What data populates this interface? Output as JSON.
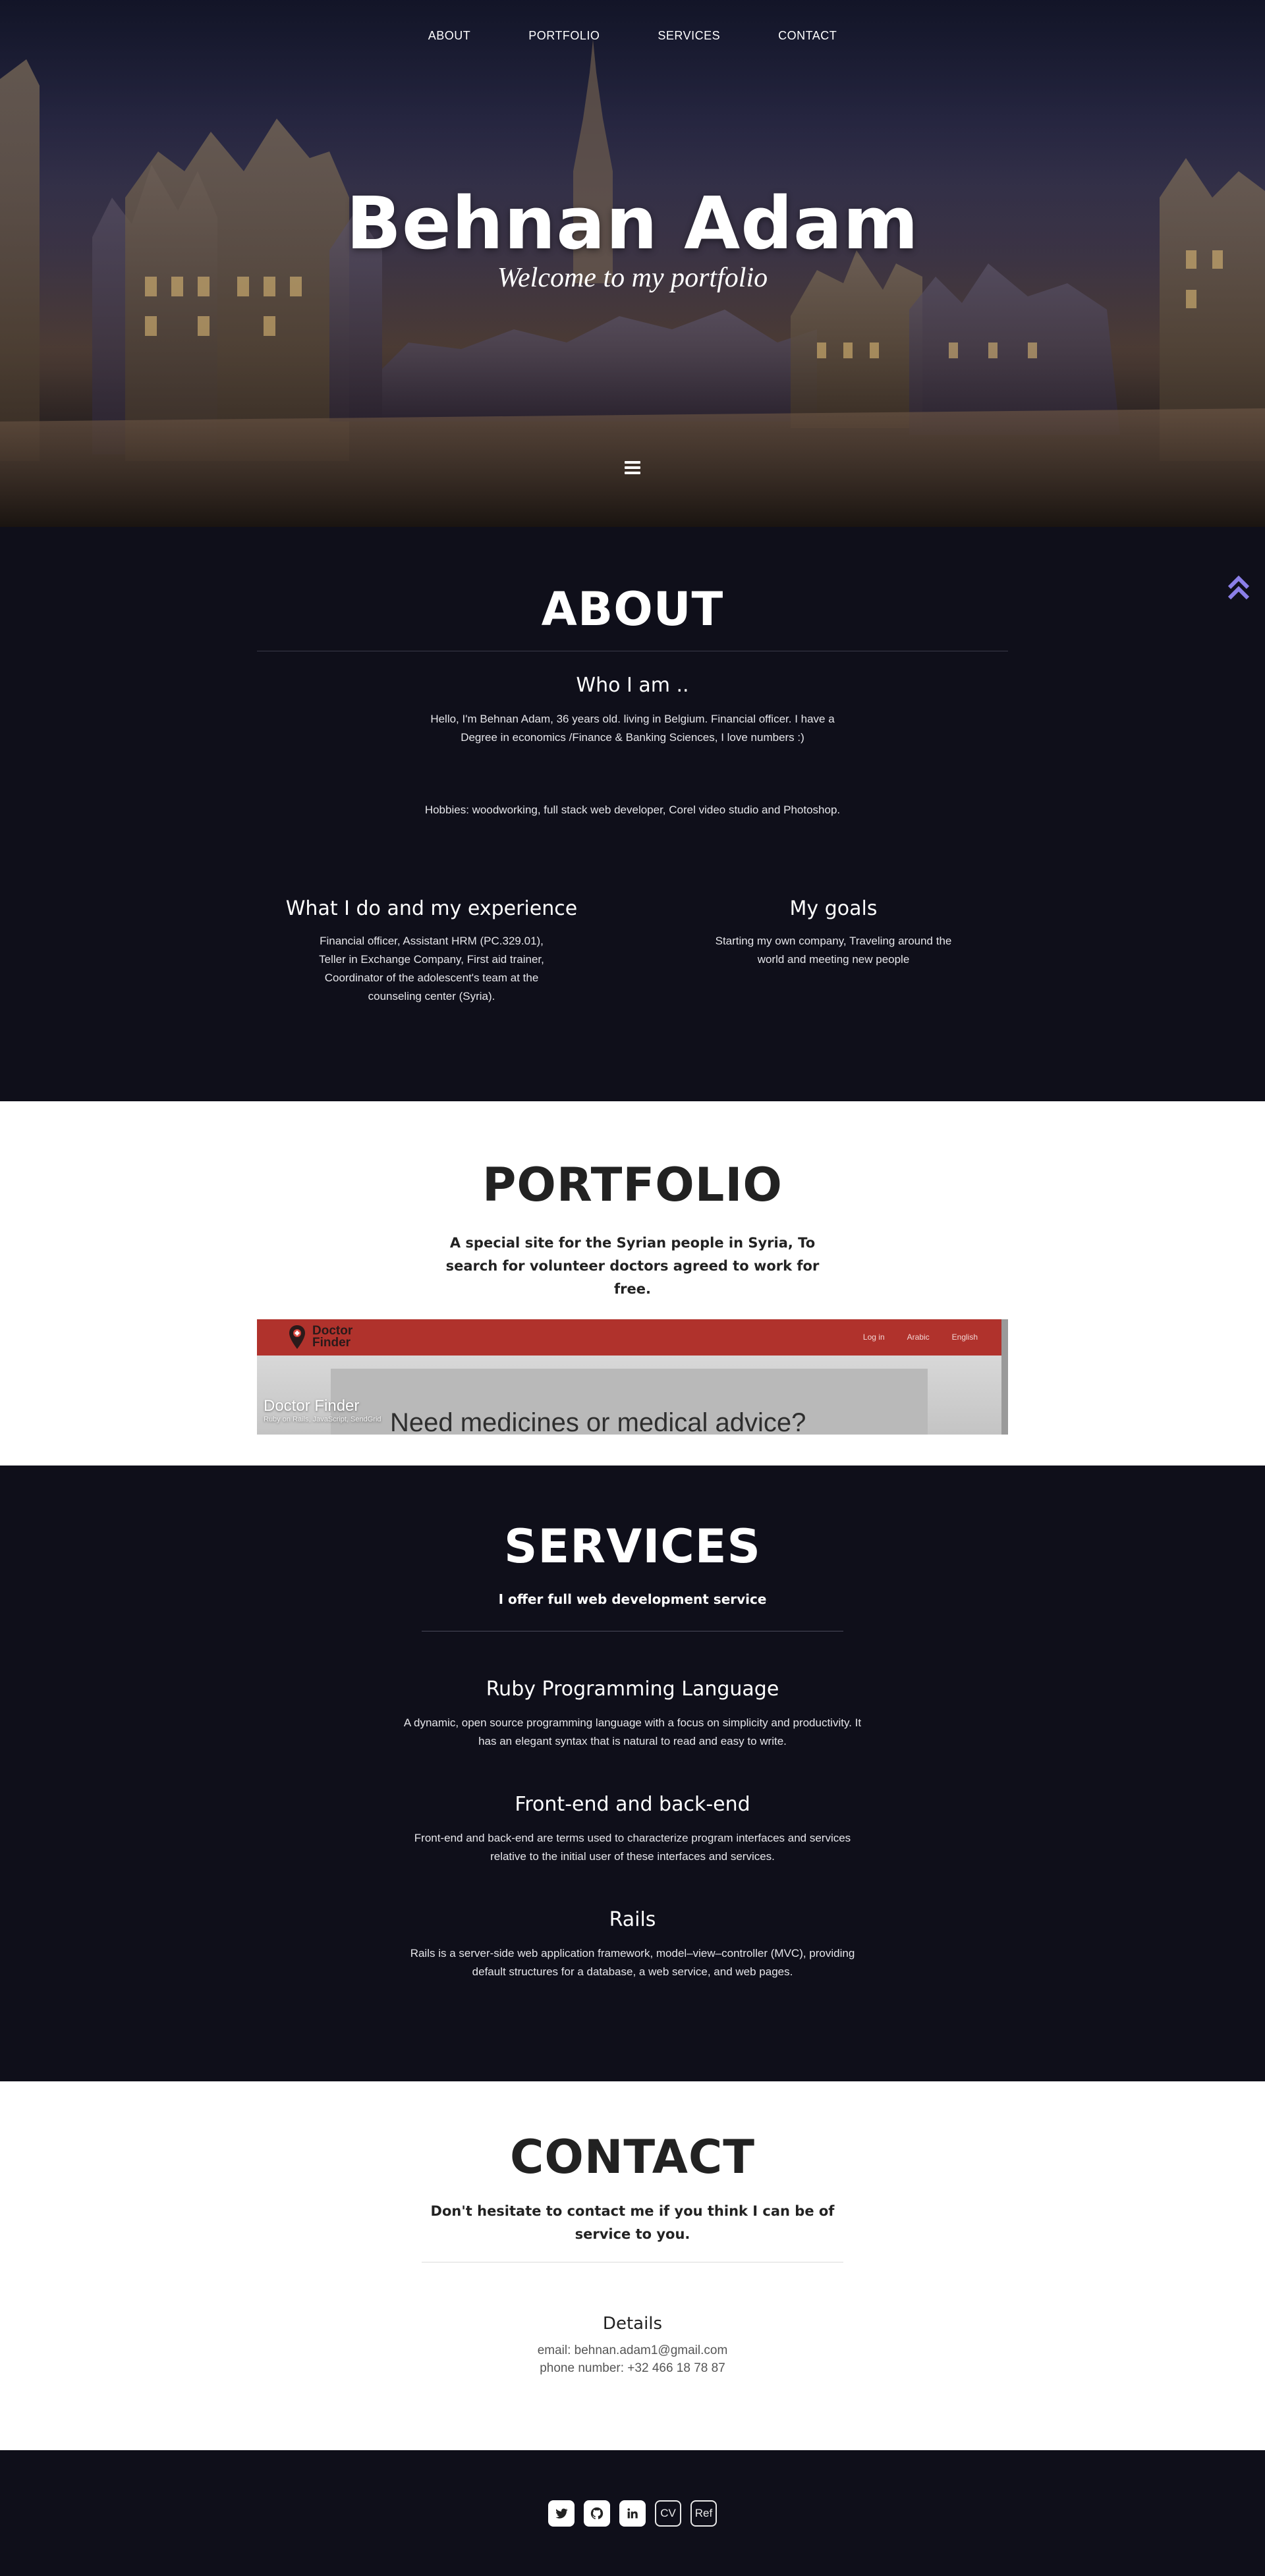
{
  "nav": {
    "about": "ABOUT",
    "portfolio": "PORTFOLIO",
    "services": "SERVICES",
    "contact": "CONTACT"
  },
  "hero": {
    "title": "Behnan Adam",
    "subtitle": "Welcome to my portfolio",
    "menu_icon": "hamburger-icon"
  },
  "about": {
    "title": "ABOUT",
    "who_heading": "Who I am ..",
    "who_text": "Hello, I'm Behnan Adam, 36 years old. living in Belgium. Financial officer. I have a Degree in economics /Finance & Banking Sciences, I love numbers :)",
    "hobbies": "Hobbies: woodworking, full stack web developer, Corel video studio and Photoshop.",
    "experience_heading": "What I do and my experience",
    "experience_text": "Financial officer, Assistant HRM (PC.329.01), Teller in Exchange Company, First aid trainer, Coordinator of the adolescent's team at the counseling center (Syria).",
    "goals_heading": "My goals",
    "goals_text": "Starting my own company, Traveling around the world and meeting new people",
    "back_to_top_icon": "double-chevron-up-icon",
    "back_to_top_color": "#8b7fe8"
  },
  "portfolio": {
    "title": "PORTFOLIO",
    "lead": "A special site for the Syrian people in Syria, To search for volunteer doctors agreed to work for free.",
    "project": {
      "brand_line1": "Doctor",
      "brand_line2": "Finder",
      "links": [
        "Log in",
        "Arabic",
        "English"
      ],
      "headline": "Need medicines or medical advice?",
      "caption_title": "Doctor Finder",
      "caption_sub": "Ruby on Rails, JavaScript, SendGrid",
      "bar_color": "#b0322c"
    }
  },
  "services": {
    "title": "SERVICES",
    "lead": "I offer full web development service",
    "items": [
      {
        "heading": "Ruby Programming Language",
        "text": "A dynamic, open source programming language with a focus on simplicity and productivity. It has an elegant syntax that is natural to read and easy to write."
      },
      {
        "heading": "Front-end and back-end",
        "text": "Front-end and back-end are terms used to characterize program interfaces and services relative to the initial user of these interfaces and services."
      },
      {
        "heading": "Rails",
        "text": "Rails is a server-side web application framework, model–view–controller (MVC), providing default structures for a database, a web service, and web pages."
      }
    ]
  },
  "contact": {
    "title": "CONTACT",
    "lead": "Don't hesitate to contact me if you think I can be of service to you.",
    "details_heading": "Details",
    "email": "email: behnan.adam1@gmail.com",
    "phone": "phone number: +32 466 18 78 87"
  },
  "footer": {
    "icons": [
      "twitter-icon",
      "github-icon",
      "linkedin-icon"
    ],
    "cv_label": "CV",
    "ref_label": "Ref"
  },
  "colors": {
    "dark_bg": "#0f0f1a",
    "light_bg": "#ffffff",
    "accent": "#8b7fe8"
  }
}
